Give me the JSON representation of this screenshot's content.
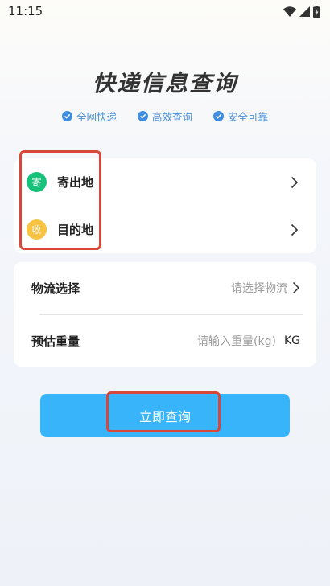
{
  "status_bar": {
    "time": "11:15"
  },
  "header": {
    "title": "快递信息查询"
  },
  "features": [
    {
      "label": "全网快递"
    },
    {
      "label": "高效查询"
    },
    {
      "label": "安全可靠"
    }
  ],
  "route": {
    "sender": {
      "badge": "寄",
      "label": "寄出地",
      "color": "#18c17a"
    },
    "receiver": {
      "badge": "收",
      "label": "目的地",
      "color": "#f6c343"
    }
  },
  "options": {
    "logistics": {
      "label": "物流选择",
      "value": "请选择物流"
    },
    "weight": {
      "label": "预估重量",
      "placeholder": "请输入重量(kg)",
      "unit": "KG"
    }
  },
  "action": {
    "query_label": "立即查询"
  },
  "colors": {
    "accent": "#38b4fb",
    "highlight": "#d9473b",
    "check": "#3d8ee0"
  }
}
